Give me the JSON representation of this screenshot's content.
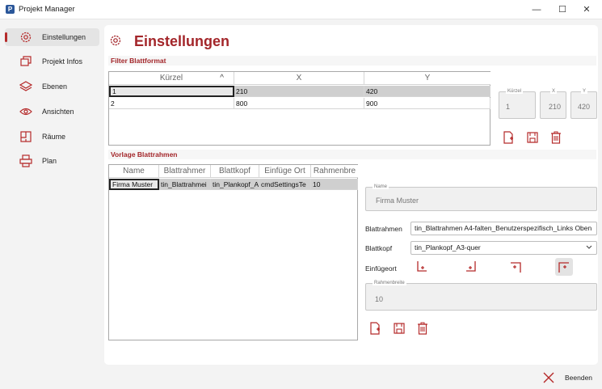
{
  "window": {
    "title": "Projekt Manager",
    "app_icon_letter": "P",
    "minimize": "—",
    "maximize": "☐",
    "close": "✕"
  },
  "sidebar": {
    "items": [
      {
        "label": "Einstellungen"
      },
      {
        "label": "Projekt Infos"
      },
      {
        "label": "Ebenen"
      },
      {
        "label": "Ansichten"
      },
      {
        "label": "Räume"
      },
      {
        "label": "Plan"
      }
    ]
  },
  "page": {
    "title": "Einstellungen"
  },
  "filter": {
    "section_title": "Filter Blattformat",
    "columns": [
      "Kürzel",
      "X",
      "Y"
    ],
    "sort_indicator": "^",
    "rows": [
      [
        "1",
        "210",
        "420"
      ],
      [
        "2",
        "800",
        "900"
      ]
    ],
    "fields": {
      "kuerzel": {
        "legend": "Kürzel",
        "value": "1"
      },
      "x": {
        "legend": "X",
        "value": "210"
      },
      "y": {
        "legend": "Y",
        "value": "420"
      }
    }
  },
  "vorlage": {
    "section_title": "Vorlage Blattrahmen",
    "columns": [
      "Name",
      "Blattrahmer",
      "Blattkopf",
      "Einfüge Ort",
      "Rahmenbre"
    ],
    "rows": [
      [
        "Firma Muster",
        "tin_Blattrahmei",
        "tin_Plankopf_A",
        "cmdSettingsTe",
        "10"
      ]
    ],
    "name": {
      "legend": "Name",
      "value": "Firma Muster"
    },
    "blattrahmen": {
      "label": "Blattrahmen",
      "value": "tin_Blattrahmen A4-falten_Benutzerspezifisch_Links Oben"
    },
    "blattkopf": {
      "label": "Blattkopf",
      "value": "tin_Plankopf_A3-quer"
    },
    "einfuegeort": {
      "label": "Einfügeort"
    },
    "rahmenbreite": {
      "legend": "Rahmenbreite",
      "value": "10"
    }
  },
  "footer": {
    "beenden_label": "Beenden"
  },
  "colors": {
    "accent": "#a3262a",
    "icon_red": "#b52a2a"
  }
}
